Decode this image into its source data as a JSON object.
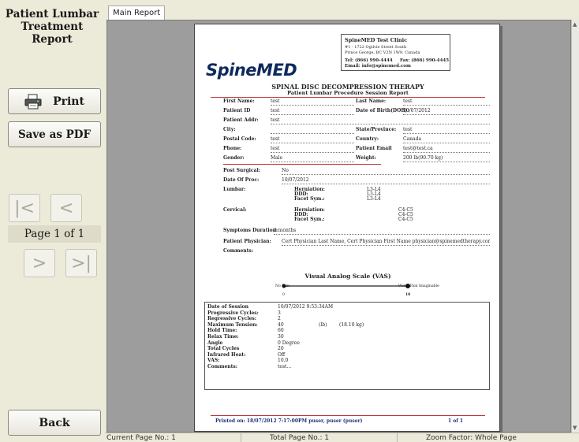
{
  "sidebar": {
    "title": "Patient Lumbar Treatment Report",
    "print_label": "Print",
    "pdf_label": "Save as PDF",
    "first_label": "|<",
    "prev_label": "<",
    "next_label": ">",
    "last_label": ">|",
    "page_indicator": "Page 1 of 1",
    "back_label": "Back"
  },
  "viewer": {
    "tab_label": "Main Report",
    "status": {
      "current_page": "Current Page No.: 1",
      "total_pages": "Total Page No.: 1",
      "zoom": "Zoom Factor: Whole Page"
    }
  },
  "report": {
    "clinic": {
      "name": "SpineMED Test Clinic",
      "address1": "#1 - 1722 Ogilvie Street South",
      "address2": "Prince George, BC V2N 1W9, Canada",
      "tel": "Tel: (866) 990-4444",
      "fax": "Fax: (866) 990-4445",
      "email": "Email: info@spinemed.com"
    },
    "logo": "SpineMED",
    "title": "SPINAL DISC DECOMPRESSION THERAPY",
    "subtitle": "Patient Lumbar Procedure Session Report",
    "patient": {
      "first_name_label": "First Name:",
      "first_name": "test",
      "last_name_label": "Last Name:",
      "last_name": "test",
      "patient_id_label": "Patient ID",
      "patient_id": "test",
      "dob_label": "Date of Birth(DOB):",
      "dob": "10/07/2012",
      "address_label": "Patient Addr:",
      "address": "test",
      "city_label": "City:",
      "city": "",
      "state_label": "State/Province:",
      "state": "test",
      "postal_label": "Postal Code:",
      "postal": "test",
      "country_label": "Country:",
      "country": "Canada",
      "phone_label": "Phone:",
      "phone": "test",
      "email_label": "Patient Email",
      "email": "test@test.ca",
      "gender_label": "Gender:",
      "gender": "Male",
      "weight_label": "Weight:",
      "weight": "200 lb(90.70 kg)"
    },
    "clinical": {
      "post_surgical_label": "Post Surgical:",
      "post_surgical": "No",
      "date_proc_label": "Date Of Proc:",
      "date_proc": "10/07/2012",
      "lumbar_label": "Lumbar:",
      "cervical_label": "Cervical:",
      "herniation_label": "Herniation:",
      "ddd_label": "DDD:",
      "facet_label": "Facet Sym.:",
      "lumbar_herniation": "L3-L4",
      "lumbar_ddd": "L3-L4",
      "lumbar_facet": "L3-L4",
      "cervical_herniation": "C4-C5",
      "cervical_ddd": "C4-C5",
      "cervical_facet": "C4-C5",
      "symptoms_label": "Symptoms Duration:",
      "symptoms": "3 months",
      "physician_label": "Patient Physician:",
      "physician": "Cert Physician Last Name, Cert Physician First Name physician@spinemedtherapy.com Cont",
      "comments_label": "Comments:"
    },
    "vas": {
      "title": "Visual Analog Scale (VAS)",
      "left_label": "No Pain",
      "right_label": "Worst Pain Imaginable",
      "min": "0",
      "max": "10",
      "value": 10
    },
    "session": {
      "labels": [
        "Date of Session",
        "Progressive Cycles:",
        "Regressive Cycles:",
        "Maximum Tension:",
        "Hold Time:",
        "Relax Time:",
        "Angle",
        "Total Cycles",
        "Infrared Heat:",
        "VAS:",
        "Comments:"
      ],
      "values": [
        "10/07/2012 9:53:34AM",
        "3",
        "2",
        "40",
        "60",
        "30",
        "0 Degree",
        "20",
        "Off",
        "10.0",
        "test..."
      ],
      "tension_unit": "(lb)",
      "tension_kg": "(18.10 kg)"
    },
    "footer": {
      "printed": "Printed on: 18/07/2012 7:17:00PM puser, puser (puser)",
      "page": "1 of 1"
    }
  },
  "colors": {
    "rule": "#bb3333",
    "logo": "#0e2a5c",
    "footer_text": "#1c2f7a"
  }
}
